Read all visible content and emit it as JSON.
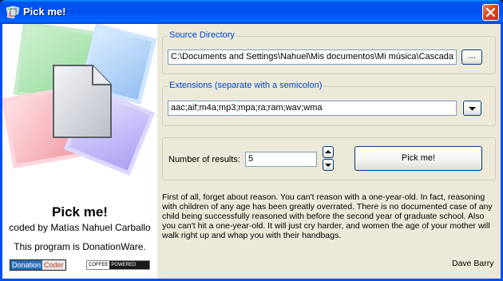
{
  "window": {
    "title": "Pick me!"
  },
  "left_panel": {
    "app_name": "Pick me!",
    "coded_by": "coded by Matías Nahuel Carballo",
    "donation_text": "This program is DonationWare.",
    "badge_donation_coder": {
      "part1": "Donation",
      "part2": "Coder"
    },
    "badge_coffee_powered": {
      "part1": "COFFEE",
      "part2": "POWERED"
    }
  },
  "source": {
    "group_label": "Source Directory",
    "path_value": "C:\\Documents and Settings\\Nahuel\\Mis documentos\\Mi música\\Cascada",
    "browse_label": "..."
  },
  "extensions": {
    "group_label": "Extensions (separate with a semicolon)",
    "value": "aac;aif;m4a;mp3;mpa;ra;ram;wav;wma"
  },
  "results": {
    "label": "Number of results:",
    "value": "5",
    "pick_button_label": "Pick me!"
  },
  "quote": {
    "text": "First of all, forget about reason. You can't reason with a one-year-old. In fact, reasoning with children of any age has been greatly overrated. There is no documented case of any child being successfully reasoned with before the second year of graduate school. Also you can't hit a one-year-old. It will just cry harder, and women the age of your mother will walk right up and whap you with their handbags.",
    "author": "Dave Barry"
  },
  "colors": {
    "accent_blue": "#0046d5",
    "titlebar_blue": "#0053ee",
    "window_bg": "#ece9d8"
  }
}
